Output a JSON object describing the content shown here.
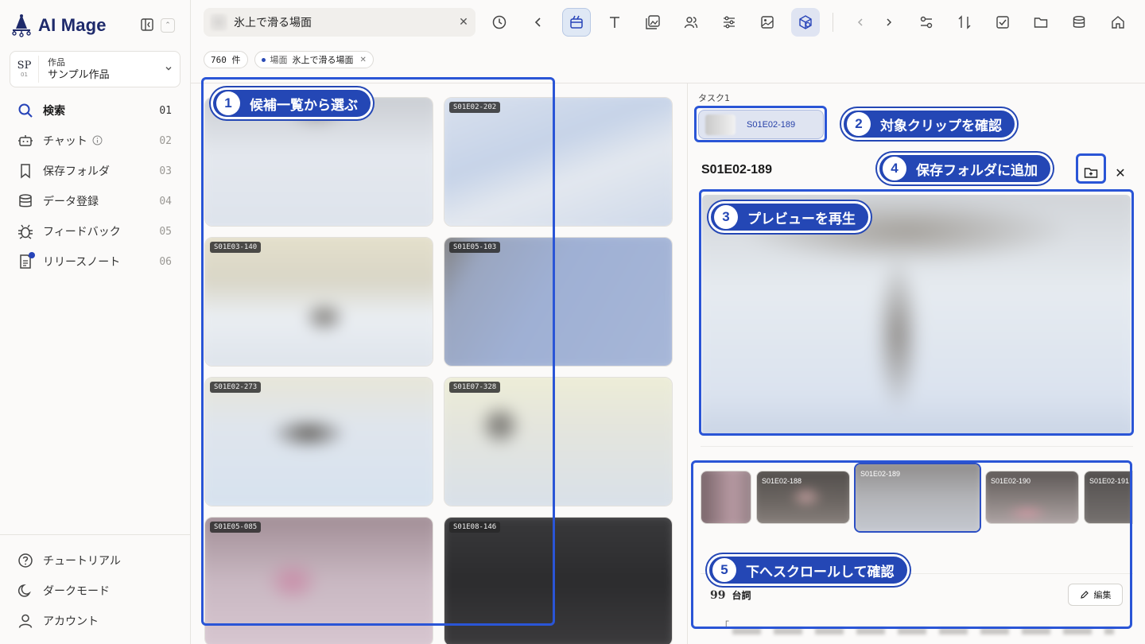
{
  "app": {
    "logo": "AI Mage"
  },
  "sidebar": {
    "project": {
      "code": "SP",
      "num": "01",
      "label": "作品",
      "value": "サンプル作品"
    },
    "items": [
      {
        "label": "検索",
        "num": "01",
        "icon": "search-icon"
      },
      {
        "label": "チャット",
        "num": "02",
        "icon": "bot-icon"
      },
      {
        "label": "保存フォルダ",
        "num": "03",
        "icon": "bookmark-icon"
      },
      {
        "label": "データ登録",
        "num": "04",
        "icon": "database-icon"
      },
      {
        "label": "フィードバック",
        "num": "05",
        "icon": "bug-icon"
      },
      {
        "label": "リリースノート",
        "num": "06",
        "icon": "notes-icon"
      }
    ],
    "bottom": [
      {
        "label": "チュートリアル",
        "icon": "help-circle-icon"
      },
      {
        "label": "ダークモード",
        "icon": "moon-icon"
      },
      {
        "label": "アカウント",
        "icon": "user-icon"
      }
    ]
  },
  "search": {
    "query": "氷上で滑る場面"
  },
  "filters": {
    "count": "760 件",
    "chip_type": "場面",
    "chip_value": "氷上で滑る場面"
  },
  "grid": {
    "tiles": [
      {
        "tag": ""
      },
      {
        "tag": "S01E02-202"
      },
      {
        "tag": "S01E03-140"
      },
      {
        "tag": "S01E05-103"
      },
      {
        "tag": "S01E02-273"
      },
      {
        "tag": "S01E07-328"
      },
      {
        "tag": "S01E05-085"
      },
      {
        "tag": "S01E08-146"
      }
    ]
  },
  "panel": {
    "task_label": "タスク1",
    "task_chip": "S01E02-189",
    "title": "S01E02-189",
    "filmstrip": [
      "",
      "S01E02-188",
      "S01E02-189",
      "S01E02-190",
      "S01E02-191"
    ],
    "dialog_label": "台詞",
    "dialog_quote": "99",
    "edit_label": "編集",
    "dialog_text": "「"
  },
  "callouts": [
    {
      "n": "1",
      "text": "候補一覧から選ぶ"
    },
    {
      "n": "2",
      "text": "対象クリップを確認"
    },
    {
      "n": "3",
      "text": "プレビューを再生"
    },
    {
      "n": "4",
      "text": "保存フォルダに追加"
    },
    {
      "n": "5",
      "text": "下へスクロールして確認"
    }
  ],
  "colors": {
    "accent": "#2447b5",
    "highlight": "#2a55d6",
    "brand": "#1e2a6b"
  }
}
